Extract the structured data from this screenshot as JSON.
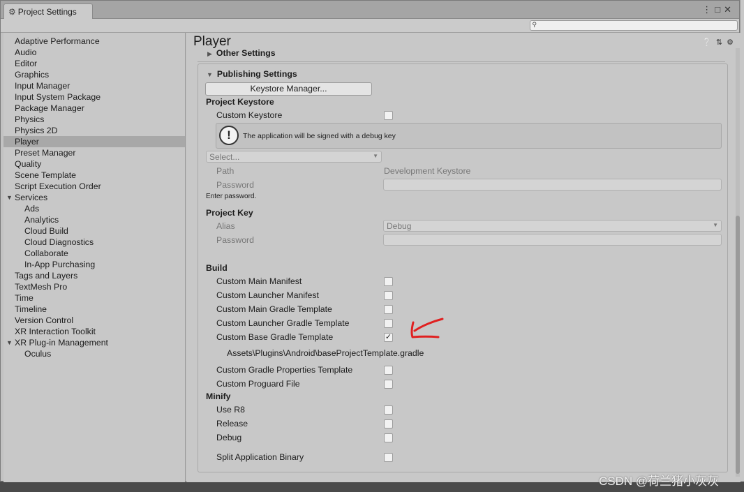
{
  "window": {
    "title": "Project Settings",
    "controls": [
      "⋮",
      "□",
      "✕"
    ]
  },
  "search": {
    "placeholder": "",
    "icon": "search-icon"
  },
  "sidebar": {
    "items": [
      {
        "label": "Adaptive Performance"
      },
      {
        "label": "Audio"
      },
      {
        "label": "Editor"
      },
      {
        "label": "Graphics"
      },
      {
        "label": "Input Manager"
      },
      {
        "label": "Input System Package"
      },
      {
        "label": "Package Manager"
      },
      {
        "label": "Physics"
      },
      {
        "label": "Physics 2D"
      },
      {
        "label": "Player",
        "selected": true
      },
      {
        "label": "Preset Manager"
      },
      {
        "label": "Quality"
      },
      {
        "label": "Scene Template"
      },
      {
        "label": "Script Execution Order"
      },
      {
        "label": "Services",
        "expanded": true
      },
      {
        "label": "Ads",
        "sub": true
      },
      {
        "label": "Analytics",
        "sub": true
      },
      {
        "label": "Cloud Build",
        "sub": true
      },
      {
        "label": "Cloud Diagnostics",
        "sub": true
      },
      {
        "label": "Collaborate",
        "sub": true
      },
      {
        "label": "In-App Purchasing",
        "sub": true
      },
      {
        "label": "Tags and Layers"
      },
      {
        "label": "TextMesh Pro"
      },
      {
        "label": "Time"
      },
      {
        "label": "Timeline"
      },
      {
        "label": "Version Control"
      },
      {
        "label": "XR Interaction Toolkit"
      },
      {
        "label": "XR Plug-in Management",
        "expanded": true
      },
      {
        "label": "Oculus",
        "sub": true
      }
    ]
  },
  "main": {
    "title": "Player",
    "header_icons": [
      "help-icon",
      "sliders-icon",
      "gear-icon"
    ],
    "other_settings": "Other Settings",
    "publishing": {
      "title": "Publishing Settings",
      "keystore_manager_button": "Keystore Manager...",
      "project_keystore": "Project Keystore",
      "custom_keystore": "Custom Keystore",
      "custom_keystore_checked": false,
      "help_text": "The application will be signed with a debug key",
      "select_placeholder": "Select...",
      "path_label": "Path",
      "path_value": "Development Keystore",
      "password_label": "Password",
      "enter_password": "Enter password.",
      "project_key": "Project Key",
      "alias_label": "Alias",
      "alias_value": "Debug",
      "key_password_label": "Password",
      "build": {
        "title": "Build",
        "items": [
          {
            "label": "Custom Main Manifest",
            "checked": false
          },
          {
            "label": "Custom Launcher Manifest",
            "checked": false
          },
          {
            "label": "Custom Main Gradle Template",
            "checked": false
          },
          {
            "label": "Custom Launcher Gradle Template",
            "checked": false
          },
          {
            "label": "Custom Base Gradle Template",
            "checked": true
          }
        ],
        "base_gradle_path": "Assets\\Plugins\\Android\\baseProjectTemplate.gradle",
        "items2": [
          {
            "label": "Custom Gradle Properties Template",
            "checked": false
          },
          {
            "label": "Custom Proguard File",
            "checked": false
          }
        ]
      },
      "minify": {
        "title": "Minify",
        "items": [
          {
            "label": "Use R8",
            "checked": false
          },
          {
            "label": "Release",
            "checked": false
          },
          {
            "label": "Debug",
            "checked": false
          }
        ]
      },
      "split_binary": {
        "label": "Split Application Binary",
        "checked": false
      }
    }
  },
  "watermark": "CSDN @荷兰猪小灰灰",
  "colors": {
    "annotation": "#e02020",
    "selected_row": "#a8a8a8"
  }
}
